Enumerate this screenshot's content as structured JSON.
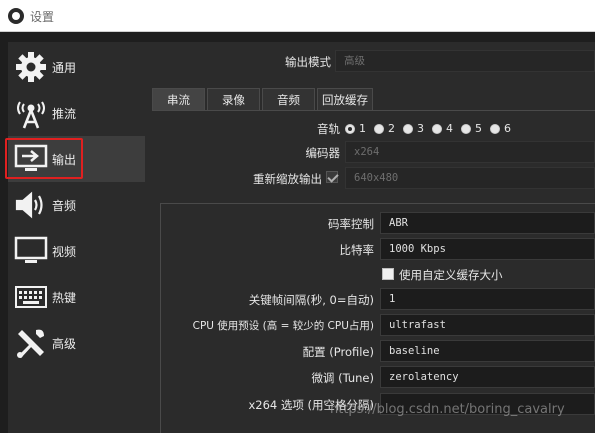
{
  "window": {
    "title": "设置"
  },
  "sidebar": {
    "items": [
      {
        "label": "通用",
        "icon": "gear-icon"
      },
      {
        "label": "推流",
        "icon": "antenna-icon"
      },
      {
        "label": "输出",
        "icon": "output-monitor-icon",
        "active": true
      },
      {
        "label": "音频",
        "icon": "speaker-icon"
      },
      {
        "label": "视频",
        "icon": "monitor-icon"
      },
      {
        "label": "热键",
        "icon": "keyboard-icon"
      },
      {
        "label": "高级",
        "icon": "tools-icon"
      }
    ]
  },
  "output": {
    "mode_label": "输出模式",
    "mode_value": "高级",
    "tabs": [
      "串流",
      "录像",
      "音频",
      "回放缓存"
    ],
    "active_tab": "串流",
    "track_label": "音轨",
    "tracks": [
      "1",
      "2",
      "3",
      "4",
      "5",
      "6"
    ],
    "selected_track": "1",
    "encoder_label": "编码器",
    "encoder_value": "x264",
    "rescale_label": "重新缩放输出",
    "rescale_value": "640x480",
    "rate_control_label": "码率控制",
    "rate_control_value": "ABR",
    "bitrate_label": "比特率",
    "bitrate_value": "1000 Kbps",
    "custom_buffer_label": "使用自定义缓存大小",
    "keyframe_label": "关键帧间隔(秒, 0=自动)",
    "keyframe_value": "1",
    "preset_label": "CPU 使用预设 (高 = 较少的 CPU占用)",
    "preset_value": "ultrafast",
    "profile_label": "配置 (Profile)",
    "profile_value": "baseline",
    "tune_label": "微调 (Tune)",
    "tune_value": "zerolatency",
    "x264_opts_label": "x264 选项 (用空格分隔)"
  },
  "watermark": "https://blog.csdn.net/boring_cavalry",
  "colors": {
    "highlight": "#e02020",
    "panel": "#2b2b2b",
    "field": "#1c1c1c"
  }
}
